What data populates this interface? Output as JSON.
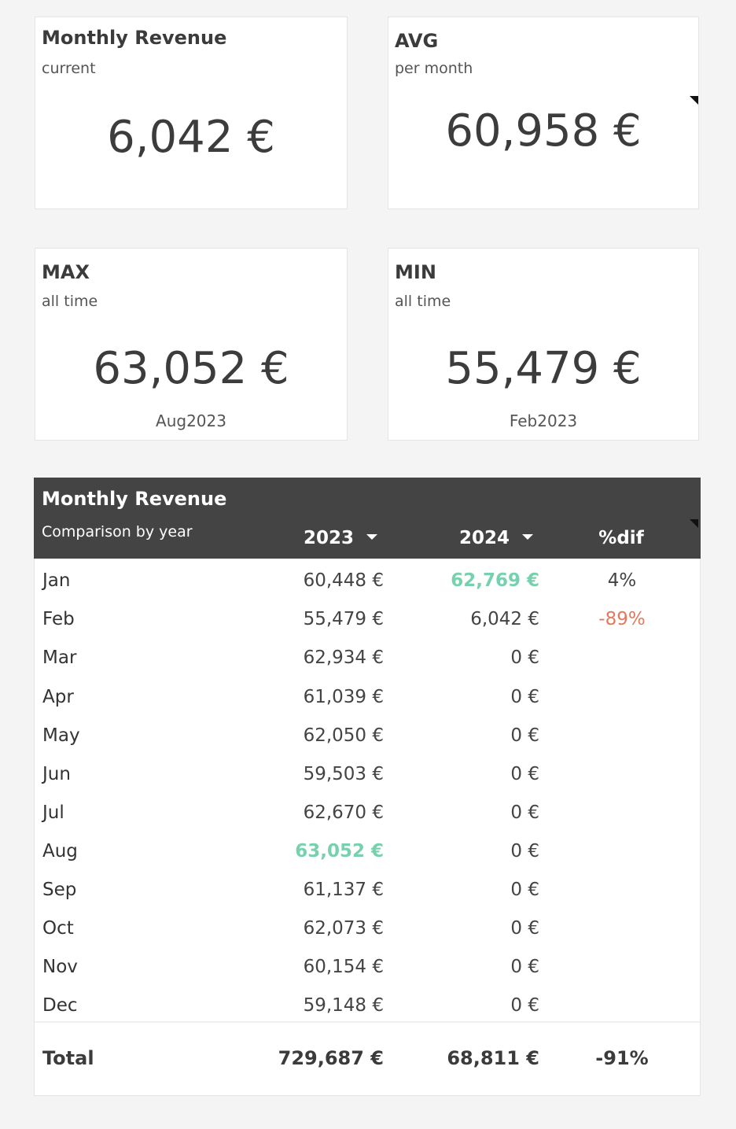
{
  "cards": {
    "current": {
      "title": "Monthly Revenue",
      "subtitle": "current",
      "value": "6,042 €"
    },
    "avg": {
      "title": "AVG",
      "subtitle": "per month",
      "value": "60,958 €"
    },
    "max": {
      "title": "MAX",
      "subtitle": "all time",
      "value": "63,052 €",
      "period": "Aug2023"
    },
    "min": {
      "title": "MIN",
      "subtitle": "all time",
      "value": "55,479 €",
      "period": "Feb2023"
    }
  },
  "table": {
    "title": "Monthly Revenue",
    "subtitle": "Comparison by year",
    "columns": [
      "2023",
      "2024",
      "%dif"
    ],
    "rows": [
      {
        "month": "Jan",
        "y2023": "60,448 €",
        "y2024": "62,769 €",
        "dif": "4%"
      },
      {
        "month": "Feb",
        "y2023": "55,479 €",
        "y2024": "6,042 €",
        "dif": "-89%"
      },
      {
        "month": "Mar",
        "y2023": "62,934 €",
        "y2024": "0 €",
        "dif": ""
      },
      {
        "month": "Apr",
        "y2023": "61,039 €",
        "y2024": "0 €",
        "dif": ""
      },
      {
        "month": "May",
        "y2023": "62,050 €",
        "y2024": "0 €",
        "dif": ""
      },
      {
        "month": "Jun",
        "y2023": "59,503 €",
        "y2024": "0 €",
        "dif": ""
      },
      {
        "month": "Jul",
        "y2023": "62,670 €",
        "y2024": "0 €",
        "dif": ""
      },
      {
        "month": "Aug",
        "y2023": "63,052 €",
        "y2024": "0 €",
        "dif": ""
      },
      {
        "month": "Sep",
        "y2023": "61,137 €",
        "y2024": "0 €",
        "dif": ""
      },
      {
        "month": "Oct",
        "y2023": "62,073 €",
        "y2024": "0 €",
        "dif": ""
      },
      {
        "month": "Nov",
        "y2023": "60,154 €",
        "y2024": "0 €",
        "dif": ""
      },
      {
        "month": "Dec",
        "y2023": "59,148 €",
        "y2024": "0 €",
        "dif": ""
      }
    ],
    "total": {
      "label": "Total",
      "y2023": "729,687 €",
      "y2024": "68,811 €",
      "dif": "-91%"
    }
  },
  "colors": {
    "header_bg": "#444444",
    "highlight_max": "#77d0ae",
    "negative": "#e07a5f",
    "page_bg": "#f4f4f4"
  }
}
